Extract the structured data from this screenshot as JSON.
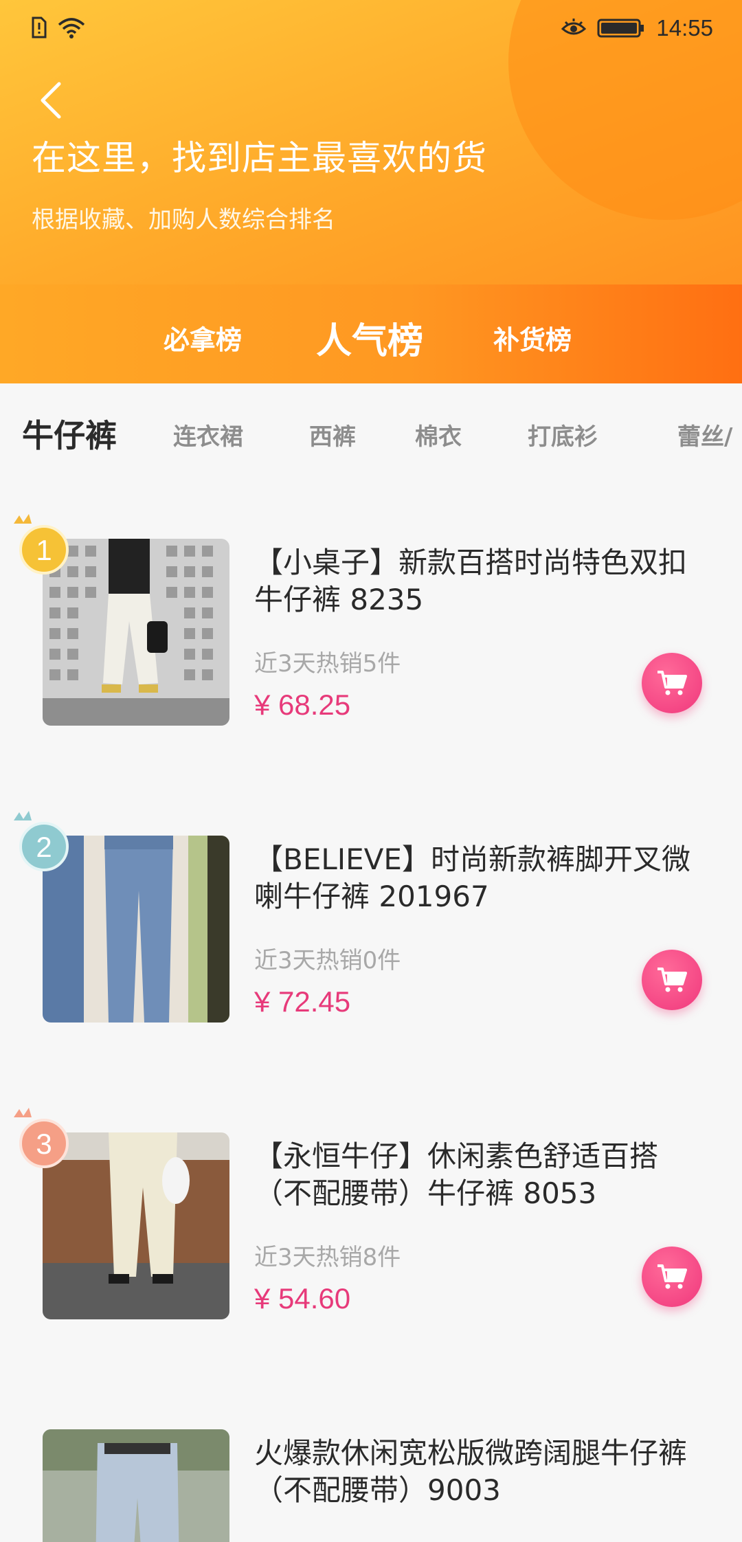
{
  "status_bar": {
    "time": "14:55"
  },
  "header": {
    "title": "在这里，找到店主最喜欢的货",
    "subtitle": "根据收藏、加购人数综合排名"
  },
  "rank_tabs": [
    {
      "label": "必拿榜"
    },
    {
      "label": "人气榜",
      "active": true
    },
    {
      "label": "补货榜"
    }
  ],
  "categories": [
    {
      "label": "牛仔裤",
      "active": true
    },
    {
      "label": "连衣裙"
    },
    {
      "label": "西裤"
    },
    {
      "label": "棉衣"
    },
    {
      "label": "打底衫"
    },
    {
      "label": "蕾丝/"
    }
  ],
  "products": [
    {
      "rank": "1",
      "title": "【小桌子】新款百搭时尚特色双扣牛仔裤 8235",
      "sales": "近3天热销5件",
      "price": "¥ 68.25"
    },
    {
      "rank": "2",
      "title": "【BELIEVE】时尚新款裤脚开叉微喇牛仔裤 201967",
      "sales": "近3天热销0件",
      "price": "¥ 72.45"
    },
    {
      "rank": "3",
      "title": "【永恒牛仔】休闲素色舒适百搭（不配腰带）牛仔裤 8053",
      "sales": "近3天热销8件",
      "price": "¥ 54.60"
    },
    {
      "rank": "",
      "title": "火爆款休闲宽松版微跨阔腿牛仔裤（不配腰带）9003",
      "sales": "",
      "price": ""
    }
  ],
  "colors": {
    "accent_orange": "#ff9822",
    "price_pink": "#e73a7a",
    "cart_pink": "#f0387c"
  }
}
